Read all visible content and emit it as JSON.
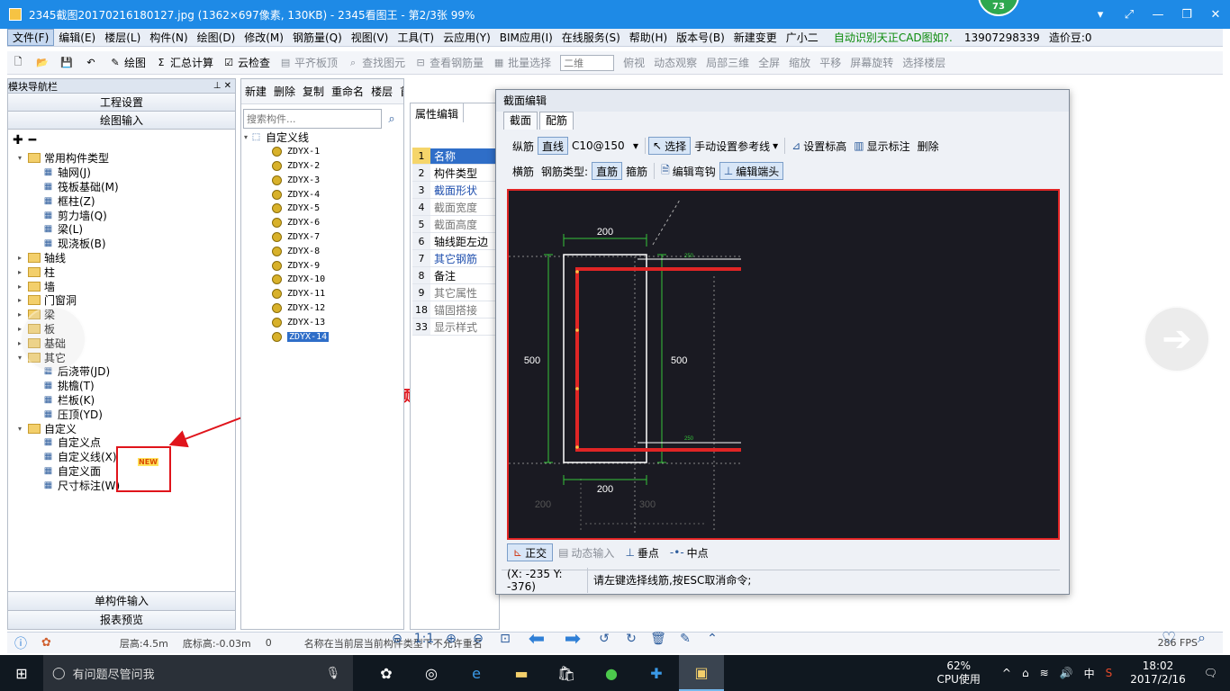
{
  "viewer": {
    "title": "2345截图20170216180127.jpg (1362×697像素, 130KB) - 2345看图王 - 第2/3张 99%",
    "badge": "73"
  },
  "menu": {
    "items": [
      "文件(F)",
      "编辑(E)",
      "楼层(L)",
      "构件(N)",
      "绘图(D)",
      "修改(M)",
      "钢筋量(Q)",
      "视图(V)",
      "工具(T)",
      "云应用(Y)",
      "BIM应用(I)",
      "在线服务(S)",
      "帮助(H)",
      "版本号(B)",
      "新建变更",
      "广小二"
    ],
    "hint": "自动识别天正CAD图如?.",
    "phone": "13907298339",
    "cost": "造价豆:0"
  },
  "toolbar": {
    "items": [
      "绘图",
      "汇总计算",
      "云检查",
      "平齐板顶",
      "查找图元",
      "查看钢筋量",
      "批量选择"
    ],
    "view_select": "二维",
    "view_items": [
      "俯视",
      "动态观察",
      "局部三维",
      "全屏",
      "缩放",
      "平移",
      "屏幕旋转",
      "选择楼层"
    ]
  },
  "nav": {
    "header": "模块导航栏",
    "sections": [
      "工程设置",
      "绘图输入"
    ],
    "tree": [
      {
        "label": "常用构件类型",
        "level": 0,
        "type": "folder",
        "expanded": true
      },
      {
        "label": "轴网(J)",
        "level": 1,
        "type": "item"
      },
      {
        "label": "筏板基础(M)",
        "level": 1,
        "type": "item"
      },
      {
        "label": "框柱(Z)",
        "level": 1,
        "type": "item"
      },
      {
        "label": "剪力墙(Q)",
        "level": 1,
        "type": "item"
      },
      {
        "label": "梁(L)",
        "level": 1,
        "type": "item"
      },
      {
        "label": "现浇板(B)",
        "level": 1,
        "type": "item"
      },
      {
        "label": "轴线",
        "level": 0,
        "type": "folder",
        "expanded": false
      },
      {
        "label": "柱",
        "level": 0,
        "type": "folder",
        "expanded": false
      },
      {
        "label": "墙",
        "level": 0,
        "type": "folder",
        "expanded": false
      },
      {
        "label": "门窗洞",
        "level": 0,
        "type": "folder",
        "expanded": false
      },
      {
        "label": "梁",
        "level": 0,
        "type": "folder",
        "expanded": false
      },
      {
        "label": "板",
        "level": 0,
        "type": "folder",
        "expanded": false
      },
      {
        "label": "基础",
        "level": 0,
        "type": "folder",
        "expanded": false
      },
      {
        "label": "其它",
        "level": 0,
        "type": "folder",
        "expanded": true
      },
      {
        "label": "后浇带(JD)",
        "level": 1,
        "type": "item"
      },
      {
        "label": "挑檐(T)",
        "level": 1,
        "type": "item"
      },
      {
        "label": "栏板(K)",
        "level": 1,
        "type": "item"
      },
      {
        "label": "压顶(YD)",
        "level": 1,
        "type": "item"
      },
      {
        "label": "自定义",
        "level": 0,
        "type": "folder",
        "expanded": true
      },
      {
        "label": "自定义点",
        "level": 1,
        "type": "item"
      },
      {
        "label": "自定义线(X)",
        "level": 1,
        "type": "item"
      },
      {
        "label": "自定义面",
        "level": 1,
        "type": "item"
      },
      {
        "label": "尺寸标注(W)",
        "level": 1,
        "type": "item"
      }
    ],
    "new_tag": "NEW",
    "bottom": [
      "单构件输入",
      "报表预览"
    ]
  },
  "annotation": "点开看一下视频。",
  "list": {
    "toolbar": [
      "新建",
      "删除",
      "复制",
      "重命名",
      "楼层",
      "首层"
    ],
    "search_placeholder": "搜索构件...",
    "root": "自定义线",
    "items": [
      "ZDYX-1",
      "ZDYX-2",
      "ZDYX-3",
      "ZDYX-4",
      "ZDYX-5",
      "ZDYX-6",
      "ZDYX-7",
      "ZDYX-8",
      "ZDYX-9",
      "ZDYX-10",
      "ZDYX-11",
      "ZDYX-12",
      "ZDYX-13",
      "ZDYX-14"
    ],
    "selected": "ZDYX-14"
  },
  "props": {
    "tab": "属性编辑",
    "rows": [
      {
        "no": "1",
        "name": "名称",
        "style": "sel"
      },
      {
        "no": "2",
        "name": "构件类型",
        "style": ""
      },
      {
        "no": "3",
        "name": "截面形状",
        "style": "blue"
      },
      {
        "no": "4",
        "name": "截面宽度",
        "style": "grey"
      },
      {
        "no": "5",
        "name": "截面高度",
        "style": "grey"
      },
      {
        "no": "6",
        "name": "轴线距左边",
        "style": ""
      },
      {
        "no": "7",
        "name": "其它钢筋",
        "style": "blue"
      },
      {
        "no": "8",
        "name": "备注",
        "style": ""
      },
      {
        "no": "9",
        "name": "其它属性",
        "style": "grey"
      },
      {
        "no": "18",
        "name": "锚固搭接",
        "style": "grey"
      },
      {
        "no": "33",
        "name": "显示样式",
        "style": "grey"
      }
    ]
  },
  "dialog": {
    "title": "截面编辑",
    "tabs": [
      "截面",
      "配筋"
    ],
    "row1": {
      "label": "纵筋",
      "line": "直线",
      "spec": "C10@150",
      "select": "选择",
      "ref": "手动设置参考线",
      "elev": "设置标高",
      "show": "显示标注",
      "delete": "删除"
    },
    "row2": {
      "label": "横筋",
      "type_label": "钢筋类型:",
      "straight": "直筋",
      "stirrup": "箍筋",
      "bend": "编辑弯钩",
      "end": "编辑端头"
    },
    "dims": {
      "top": "200",
      "bottom": "200",
      "left": "500",
      "right": "500",
      "far_left": "200",
      "far_right": "300",
      "tag_top": "250",
      "tag_bottom": "250"
    },
    "bottom": {
      "ortho": "正交",
      "dynamic": "动态输入",
      "perp": "垂点",
      "mid": "中点"
    },
    "coord": "(X: -235 Y: -376)",
    "status": "请左键选择线筋,按ESC取消命令;"
  },
  "status": {
    "floor_height": "层高:4.5m",
    "base_elev": "底标高:-0.03m",
    "zero": "0",
    "msg": "名称在当前层当前构件类型下不允许重名",
    "fps": "286 FPS"
  },
  "taskbar": {
    "search": "有问题尽管问我",
    "cpu_pct": "62%",
    "cpu_label": "CPU使用",
    "ime": "中",
    "time": "18:02",
    "date": "2017/2/16"
  }
}
